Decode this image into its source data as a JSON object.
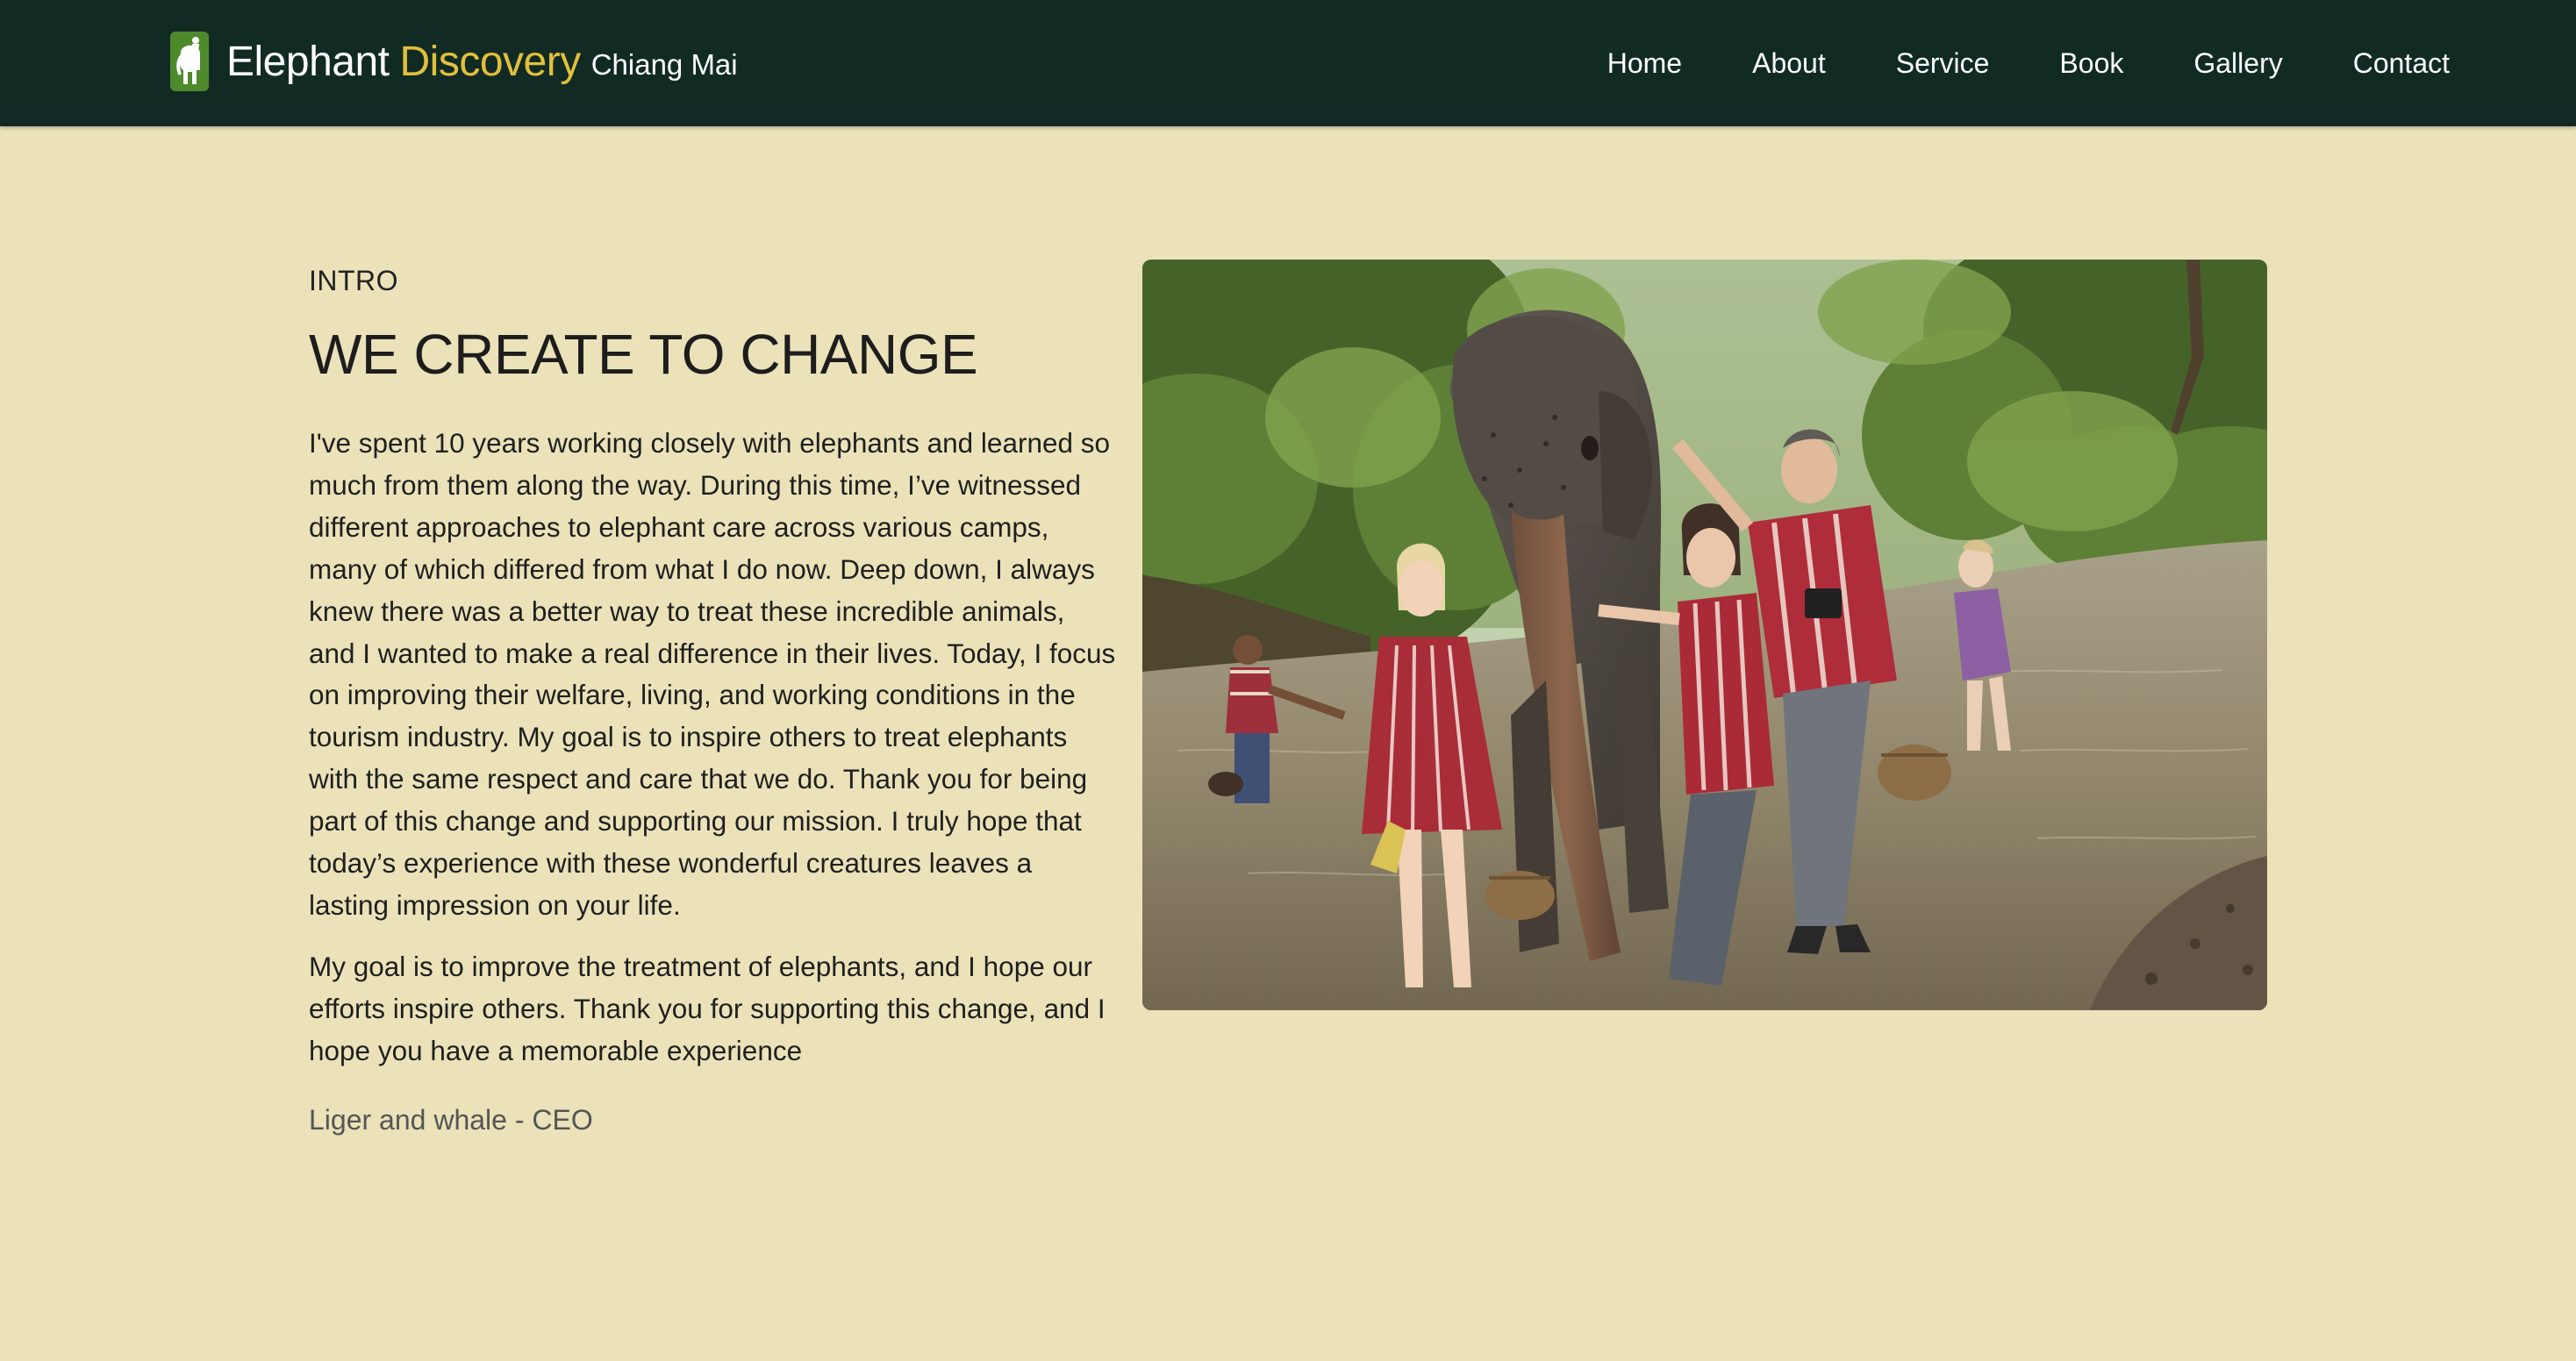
{
  "header": {
    "brand_primary": "Elephant",
    "brand_secondary": "Discovery",
    "brand_location": "Chiang Mai",
    "logo_icon": "elephant-logo-icon",
    "nav": [
      "Home",
      "About",
      "Service",
      "Book",
      "Gallery",
      "Contact"
    ]
  },
  "intro": {
    "eyebrow": "INTRO",
    "headline": "WE CREATE TO CHANGE",
    "paragraph1": "I've spent 10 years working closely with elephants and learned so much from them along the way. During this time, I’ve witnessed different approaches to elephant care across various camps, many of which differed from what I do now. Deep down, I always knew there was a better way to treat these incredible animals, and I wanted to make a real difference in their lives. Today, I focus on improving their welfare, living, and working conditions in the tourism industry. My goal is to inspire others to treat elephants with the same respect and care that we do. Thank you for being part of this change and supporting our mission. I truly hope that today’s experience with these wonderful creatures leaves a lasting impression on your life.",
    "paragraph2": "My goal is to improve the treatment of elephants, and I hope our efforts inspire others. Thank you for supporting this change, and I hope you have a memorable experience",
    "signature": "Liger and whale - CEO",
    "photo": "elephant-river-photo"
  },
  "colors": {
    "header_bg": "#112b24",
    "page_bg": "#ebe2b9",
    "brand_accent": "#e2bf3c"
  }
}
